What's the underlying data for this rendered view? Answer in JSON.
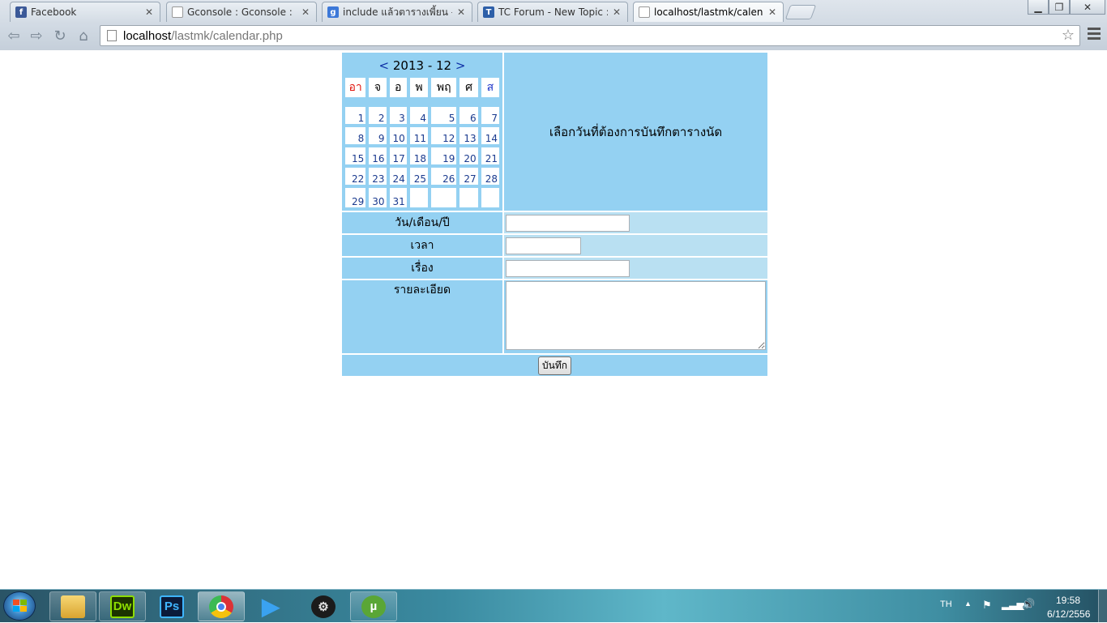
{
  "browser": {
    "tabs": [
      {
        "title": "Facebook",
        "favicon": "facebook-icon",
        "active": false
      },
      {
        "title": "Gconsole : Gconsole :",
        "favicon": "page-icon",
        "active": false
      },
      {
        "title": "include แล้วตารางเพี้ยน - ค้",
        "favicon": "google-icon",
        "active": false
      },
      {
        "title": "TC Forum - New Topic :: ...",
        "favicon": "forum-icon",
        "active": false
      },
      {
        "title": "localhost/lastmk/calendar",
        "favicon": "page-icon",
        "active": true
      }
    ],
    "url_host": "localhost",
    "url_path": "/lastmk/calendar.php"
  },
  "calendar": {
    "prev": "<",
    "next": ">",
    "month_label": "2013 - 12",
    "day_headers": [
      "อา",
      "จ",
      "อ",
      "พ",
      "พฤ",
      "ศ",
      "ส"
    ],
    "weeks": [
      [
        "1",
        "2",
        "3",
        "4",
        "5",
        "6",
        "7"
      ],
      [
        "8",
        "9",
        "10",
        "11",
        "12",
        "13",
        "14"
      ],
      [
        "15",
        "16",
        "17",
        "18",
        "19",
        "20",
        "21"
      ],
      [
        "22",
        "23",
        "24",
        "25",
        "26",
        "27",
        "28"
      ],
      [
        "29",
        "30",
        "31",
        "",
        "",
        "",
        ""
      ]
    ],
    "colors": {
      "sunday": "#e0140c",
      "saturday": "#1e34c8",
      "cell_bg": "#94d1f2",
      "field_bg": "#b9e0f2"
    }
  },
  "form": {
    "instruction": "เลือกวันที่ต้องการบันทึกตารางนัด",
    "date_label": "วัน/เดือน/ปี",
    "date_value": "",
    "time_label": "เวลา",
    "time_value": "",
    "subject_label": "เรื่อง",
    "subject_value": "",
    "detail_label": "รายละเอียด",
    "detail_value": "",
    "save_label": "บันทึก"
  },
  "taskbar": {
    "apps": [
      {
        "name": "explorer-icon"
      },
      {
        "name": "dreamweaver-icon",
        "label": "Dw"
      },
      {
        "name": "photoshop-icon",
        "label": "Ps"
      },
      {
        "name": "chrome-icon"
      },
      {
        "name": "media-player-icon"
      },
      {
        "name": "steam-icon"
      },
      {
        "name": "utorrent-icon"
      }
    ],
    "language": "TH",
    "time": "19:58",
    "date": "6/12/2556"
  }
}
